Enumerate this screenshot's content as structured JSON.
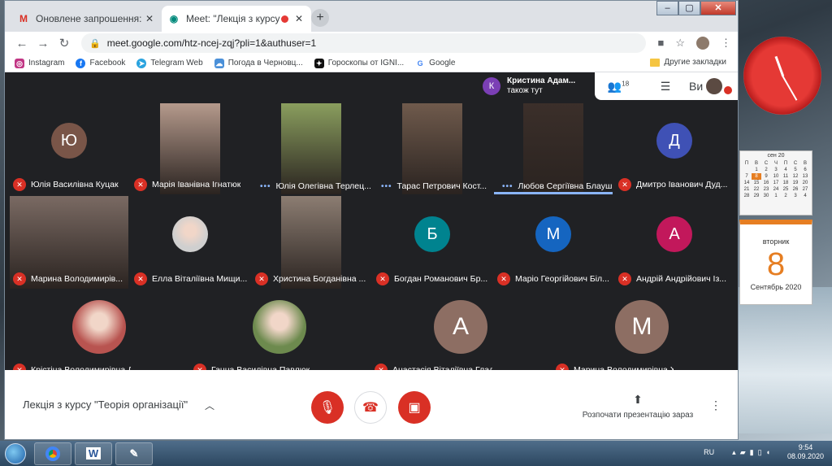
{
  "browser": {
    "tabs": [
      {
        "title": "Оновлене запрошення: Лекція з",
        "favicon": "gmail-icon",
        "favicon_color": "#d93025"
      },
      {
        "title": "Meet: \"Лекція з курсу \"Теор",
        "favicon": "meet-icon",
        "favicon_color": "#00897b",
        "recording": true
      }
    ],
    "url": "meet.google.com/htz-ncej-zqj?pli=1&authuser=1",
    "bookmarks": [
      {
        "label": "Instagram",
        "color": "#c13584"
      },
      {
        "label": "Facebook",
        "color": "#1877f2"
      },
      {
        "label": "Telegram Web",
        "color": "#2aa3df"
      },
      {
        "label": "Погода в Черновц...",
        "color": "#4a90d9"
      },
      {
        "label": "Гороскопы от IGNI...",
        "color": "#111111"
      },
      {
        "label": "Google",
        "color": "#4285f4"
      }
    ],
    "other_bookmarks": "Другие закладки"
  },
  "meet": {
    "joined_notice": {
      "initial": "К",
      "name": "Кристина Адам...",
      "text": "також тут"
    },
    "participant_count": "18",
    "self_label": "Ви",
    "participants": [
      {
        "name": "Юлія Василівна Куцак",
        "initial": "Ю",
        "avatar_color": "#795548",
        "type": "avatar"
      },
      {
        "name": "Марія Іванівна Ігнатюк",
        "type": "video",
        "video_color": "#b59a8c"
      },
      {
        "name": "Юлія Олегівна Терлец...",
        "type": "video",
        "video_color": "#8a9e5e",
        "speaking": true
      },
      {
        "name": "Тарас Петрович Кост...",
        "type": "video",
        "video_color": "#6f5a4c",
        "speaking": true
      },
      {
        "name": "Любов Сергіївна Блауш",
        "type": "video",
        "video_color": "#3b2f2a",
        "speaking": true,
        "highlight": true
      },
      {
        "name": "Дмитро Іванович Дуд...",
        "initial": "Д",
        "avatar_color": "#3f51b5",
        "type": "avatar"
      },
      {
        "name": "Марина Володимирів...",
        "type": "video",
        "video_color": "#7a6a63"
      },
      {
        "name": "Елла Віталіївна Мищи...",
        "type": "photo",
        "photo_color": "#cfcfcf"
      },
      {
        "name": "Христина Богданівна ...",
        "type": "video",
        "video_color": "#8c7d72"
      },
      {
        "name": "Богдан Романович Бр...",
        "initial": "Б",
        "avatar_color": "#00838f",
        "type": "avatar"
      },
      {
        "name": "Маріо Георгійович Біл...",
        "initial": "М",
        "avatar_color": "#1565c0",
        "type": "avatar"
      },
      {
        "name": "Андрій Андрійович Із...",
        "initial": "А",
        "avatar_color": "#c2185b",
        "type": "avatar"
      },
      {
        "name": "Крістіна Володимирівна Дроняк",
        "type": "photo",
        "photo_color": "#b85450"
      },
      {
        "name": "Ганна Василівна Павлюк",
        "type": "photo",
        "photo_color": "#6d8a4e"
      },
      {
        "name": "Анастасія Віталіївна Гладиш",
        "initial": "А",
        "avatar_color": "#8d6e63",
        "type": "avatar"
      },
      {
        "name": "Марина Володимирівна Хникіна",
        "initial": "М",
        "avatar_color": "#8d6e63",
        "type": "avatar"
      }
    ],
    "meeting_title": "Лекція з курсу \"Теорія організації\"",
    "present_label": "Розпочати презентацію зараз"
  },
  "desktop": {
    "calendar": {
      "month": "сен 20",
      "weekdays": [
        "П",
        "В",
        "С",
        "Ч",
        "П",
        "С",
        "В"
      ],
      "weeks": [
        [
          "",
          "1",
          "2",
          "3",
          "4",
          "5",
          "6"
        ],
        [
          "7",
          "8",
          "9",
          "10",
          "11",
          "12",
          "13"
        ],
        [
          "14",
          "15",
          "16",
          "17",
          "18",
          "19",
          "20"
        ],
        [
          "21",
          "22",
          "23",
          "24",
          "25",
          "26",
          "27"
        ],
        [
          "28",
          "29",
          "30",
          "1",
          "2",
          "3",
          "4"
        ]
      ],
      "today": "8"
    },
    "day_card": {
      "weekday": "вторник",
      "day": "8",
      "month_year": "Сентябрь 2020"
    },
    "taskbar": {
      "lang": "RU",
      "time": "9:54",
      "date": "08.09.2020"
    }
  }
}
